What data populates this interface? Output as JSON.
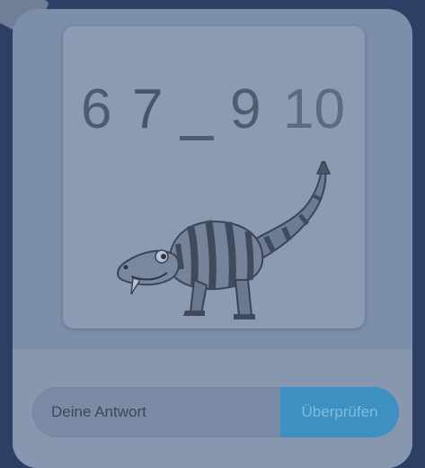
{
  "puzzle": {
    "sequence": [
      "6",
      "7",
      "9",
      "10"
    ],
    "blank_placeholder": "_",
    "illustration": "striped-dinosaur"
  },
  "answer": {
    "placeholder": "Deine Antwort",
    "value": ""
  },
  "actions": {
    "check_label": "Überprüfen"
  },
  "colors": {
    "background": "#2e3f66",
    "card": "#7d8ea8",
    "panel": "#8b9bb3",
    "button": "#3e8fc2",
    "button_text": "#7fbde0",
    "digits": "#4f5c6e"
  }
}
